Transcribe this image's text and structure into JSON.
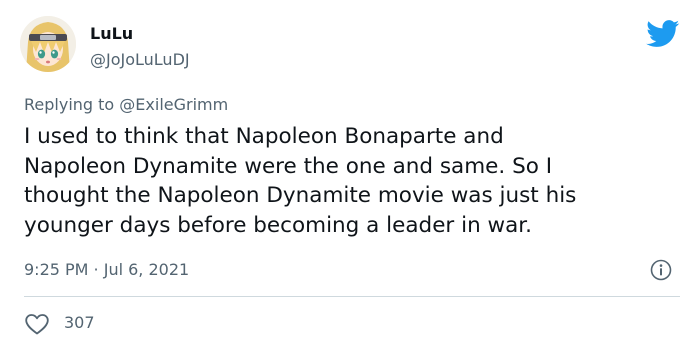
{
  "author": {
    "display_name": "LuLu",
    "handle": "@JoJoLuLuDJ",
    "avatar": "anime-avatar"
  },
  "reply": {
    "prefix": "Replying to",
    "target": "@ExileGrimm"
  },
  "tweet": {
    "lines": [
      "I used to think that Napoleon Bonaparte and",
      "Napoleon Dynamite were the one and same. So I",
      "thought the Napoleon Dynamite movie was just his",
      "younger days before becoming a leader in war."
    ],
    "timestamp": "9:25 PM · Jul 6, 2021"
  },
  "engagement": {
    "likes": "307"
  },
  "icons": {
    "brand": "twitter-bird-icon",
    "info": "info-icon",
    "like": "heart-icon"
  },
  "colors": {
    "brand_blue": "#1d9bf0",
    "text_primary": "#0f1419",
    "text_secondary": "#536471",
    "divider": "#cfd9de"
  }
}
